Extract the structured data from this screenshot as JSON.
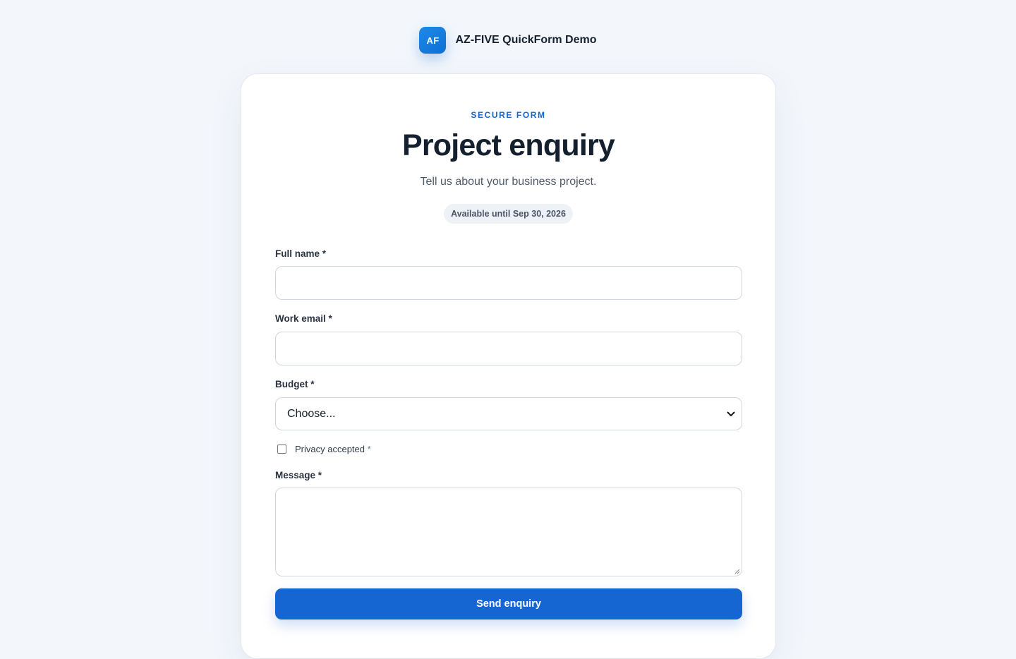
{
  "brand": {
    "logo_text": "AF",
    "name": "AZ-FIVE QuickForm Demo"
  },
  "form": {
    "eyebrow": "SECURE FORM",
    "title": "Project enquiry",
    "subtitle": "Tell us about your business project.",
    "availability": "Available until Sep 30, 2026",
    "fields": {
      "full_name": {
        "label": "Full name *",
        "value": ""
      },
      "work_email": {
        "label": "Work email *",
        "value": ""
      },
      "budget": {
        "label": "Budget *",
        "selected": "Choose..."
      },
      "privacy": {
        "label": "Privacy accepted",
        "required_mark": "*",
        "checked": false
      },
      "message": {
        "label": "Message *",
        "value": ""
      }
    },
    "submit_label": "Send enquiry"
  },
  "colors": {
    "accent": "#1565d3",
    "background": "#f3f7fc",
    "card": "#ffffff"
  },
  "icons": {
    "select_arrow": "chevron-down-icon",
    "textarea_resize": "resize-grip-icon"
  }
}
